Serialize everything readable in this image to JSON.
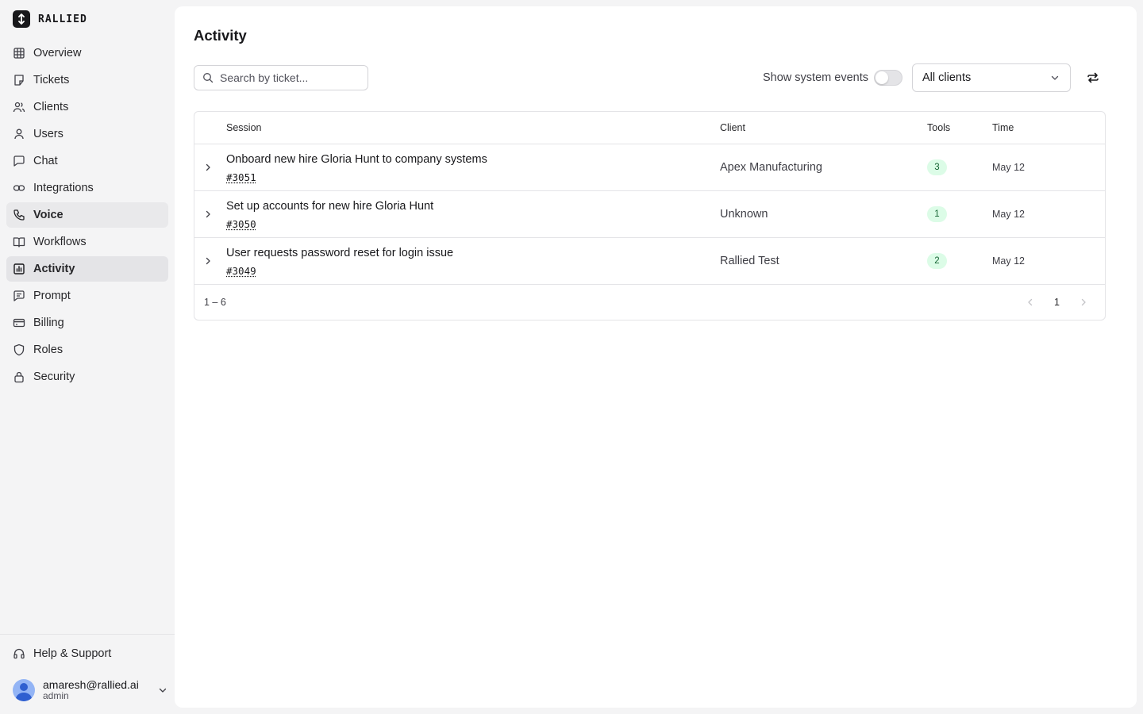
{
  "brand": {
    "name": "RALLIED"
  },
  "sidebar": {
    "items": [
      {
        "label": "Overview",
        "icon": "grid-icon"
      },
      {
        "label": "Tickets",
        "icon": "sticky-note-icon"
      },
      {
        "label": "Clients",
        "icon": "users-icon"
      },
      {
        "label": "Users",
        "icon": "user-icon"
      },
      {
        "label": "Chat",
        "icon": "chat-bubble-icon"
      },
      {
        "label": "Integrations",
        "icon": "link-icon"
      },
      {
        "label": "Voice",
        "icon": "phone-icon"
      },
      {
        "label": "Workflows",
        "icon": "book-icon"
      },
      {
        "label": "Activity",
        "icon": "bar-chart-icon"
      },
      {
        "label": "Prompt",
        "icon": "message-square-icon"
      },
      {
        "label": "Billing",
        "icon": "credit-card-icon"
      },
      {
        "label": "Roles",
        "icon": "shield-icon"
      },
      {
        "label": "Security",
        "icon": "lock-icon"
      }
    ],
    "help_label": "Help & Support",
    "user": {
      "email": "amaresh@rallied.ai",
      "role": "admin"
    }
  },
  "page": {
    "title": "Activity",
    "search_placeholder": "Search by ticket...",
    "system_events_label": "Show system events",
    "system_events_on": false,
    "client_filter": "All clients"
  },
  "table": {
    "columns": {
      "session": "Session",
      "client": "Client",
      "tools": "Tools",
      "time": "Time"
    },
    "rows": [
      {
        "title": "Onboard new hire Gloria Hunt to company systems",
        "ticket": "#3051",
        "client": "Apex Manufacturing",
        "tools": "3",
        "time": "May 12"
      },
      {
        "title": "Set up accounts for new hire Gloria Hunt",
        "ticket": "#3050",
        "client": "Unknown",
        "tools": "1",
        "time": "May 12"
      },
      {
        "title": "User requests password reset for login issue",
        "ticket": "#3049",
        "client": "Rallied Test",
        "tools": "2",
        "time": "May 12"
      }
    ],
    "range": "1 – 6",
    "page": "1"
  },
  "colors": {
    "accent_badge_bg": "#dcfce7",
    "accent_badge_text": "#166534",
    "sidebar_bg": "#f4f4f5"
  }
}
